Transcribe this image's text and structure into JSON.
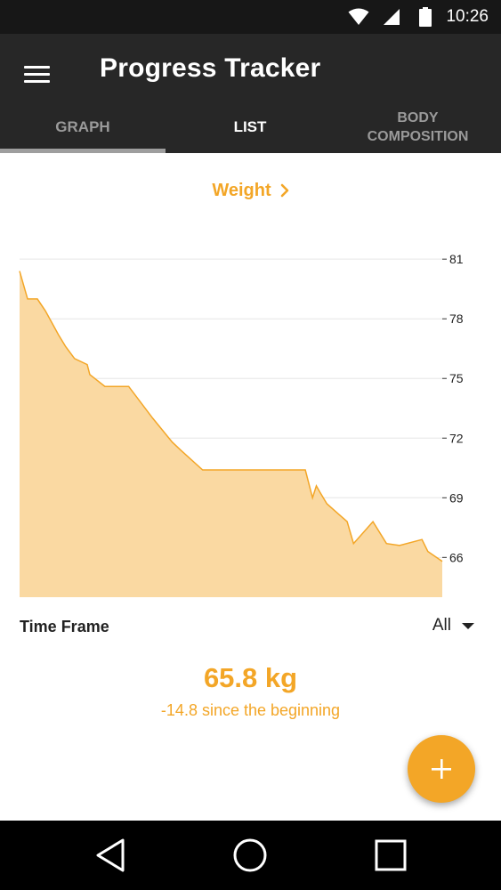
{
  "status_bar": {
    "time": "10:26",
    "icons": [
      "wifi-icon",
      "cellular-signal-icon",
      "battery-icon"
    ]
  },
  "app_bar": {
    "title": "Progress Tracker",
    "menu_icon": "hamburger-menu-icon"
  },
  "tabs": [
    {
      "label": "GRAPH",
      "active": false
    },
    {
      "label": "LIST",
      "active": true
    },
    {
      "label_lines": [
        "BODY",
        "COMPOSITION"
      ],
      "active": false
    }
  ],
  "metric": {
    "label": "Weight",
    "icon": "chevron-right-icon"
  },
  "chart_data": {
    "type": "area",
    "title": "",
    "xlabel": "",
    "ylabel": "",
    "y_ticks": [
      "81",
      "78",
      "75",
      "72",
      "69",
      "66"
    ],
    "ylim": [
      64.0,
      81.5
    ],
    "x_range": [
      0,
      100
    ],
    "grid": true,
    "axis_side": "right",
    "color": "#f3a627",
    "fill_color": "#fad9a2",
    "series": [
      {
        "x": [
          0,
          1.9,
          4.2,
          6.1,
          9.2,
          10.9,
          13.0,
          16.0,
          16.6,
          20.2,
          25.8,
          31.5,
          36.1,
          38.1,
          43.3,
          67.6,
          69.3,
          70.2,
          71.0,
          72.7,
          77.5,
          79.0,
          83.6,
          86.8,
          89.9,
          95.2,
          96.6,
          100
        ],
        "y": [
          80.4,
          79.0,
          79.0,
          78.4,
          77.2,
          76.6,
          76.0,
          75.7,
          75.2,
          74.6,
          74.6,
          73.0,
          71.8,
          71.4,
          70.4,
          70.4,
          69.0,
          69.6,
          69.3,
          68.7,
          67.8,
          66.7,
          67.8,
          66.7,
          66.6,
          66.9,
          66.3,
          65.8
        ]
      }
    ]
  },
  "time_frame": {
    "label": "Time Frame",
    "selected": "All"
  },
  "summary": {
    "current": "65.8 kg",
    "change": "-14.8 since the beginning"
  },
  "fab": {
    "icon": "plus-icon"
  },
  "nav_bar": {
    "icons": [
      "back-triangle-icon",
      "home-circle-icon",
      "recents-square-icon"
    ]
  }
}
